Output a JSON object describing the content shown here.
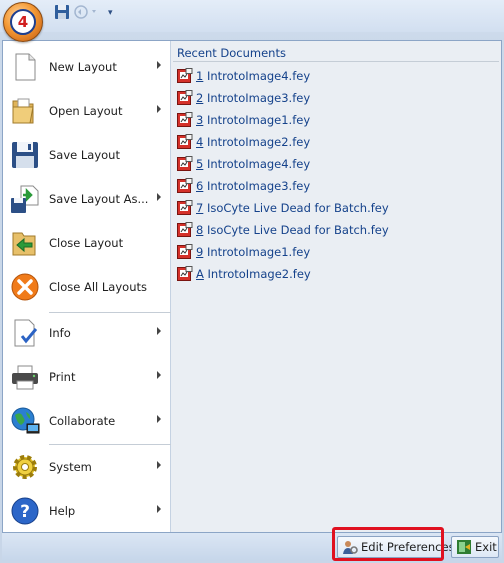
{
  "menu": {
    "items": [
      {
        "label": "New Layout",
        "has_submenu": true,
        "icon": "new-document-icon"
      },
      {
        "label": "Open Layout",
        "has_submenu": true,
        "icon": "open-folder-icon"
      },
      {
        "label": "Save Layout",
        "has_submenu": false,
        "icon": "save-disk-icon"
      },
      {
        "label": "Save Layout As...",
        "has_submenu": true,
        "icon": "save-as-icon"
      },
      {
        "label": "Close Layout",
        "has_submenu": false,
        "icon": "close-layout-icon"
      },
      {
        "label": "Close All Layouts",
        "has_submenu": false,
        "icon": "close-all-icon"
      },
      {
        "label": "Info",
        "has_submenu": true,
        "icon": "info-checklist-icon"
      },
      {
        "label": "Print",
        "has_submenu": true,
        "icon": "printer-icon"
      },
      {
        "label": "Collaborate",
        "has_submenu": true,
        "icon": "globe-network-icon"
      },
      {
        "label": "System",
        "has_submenu": true,
        "icon": "gear-icon"
      },
      {
        "label": "Help",
        "has_submenu": true,
        "icon": "help-icon"
      }
    ]
  },
  "recent": {
    "title": "Recent Documents",
    "items": [
      {
        "key": "1",
        "name": " IntrotoImage4.fey"
      },
      {
        "key": "2",
        "name": " IntrotoImage3.fey"
      },
      {
        "key": "3",
        "name": " IntrotoImage1.fey"
      },
      {
        "key": "4",
        "name": " IntrotoImage2.fey"
      },
      {
        "key": "5",
        "name": " IntrotoImage4.fey"
      },
      {
        "key": "6",
        "name": " IntrotoImage3.fey"
      },
      {
        "key": "7",
        "name": " IsoCyte Live Dead for Batch.fey"
      },
      {
        "key": "8",
        "name": " IsoCyte Live Dead for Batch.fey"
      },
      {
        "key": "9",
        "name": " IntrotoImage1.fey"
      },
      {
        "key": "A",
        "name": " IntrotoImage2.fey"
      }
    ]
  },
  "footer": {
    "edit_preferences": "Edit Preferences",
    "exit": "Exit"
  },
  "app_orb_label": "4",
  "colors": {
    "accent_link": "#15428b",
    "highlight": "#e0101f"
  }
}
